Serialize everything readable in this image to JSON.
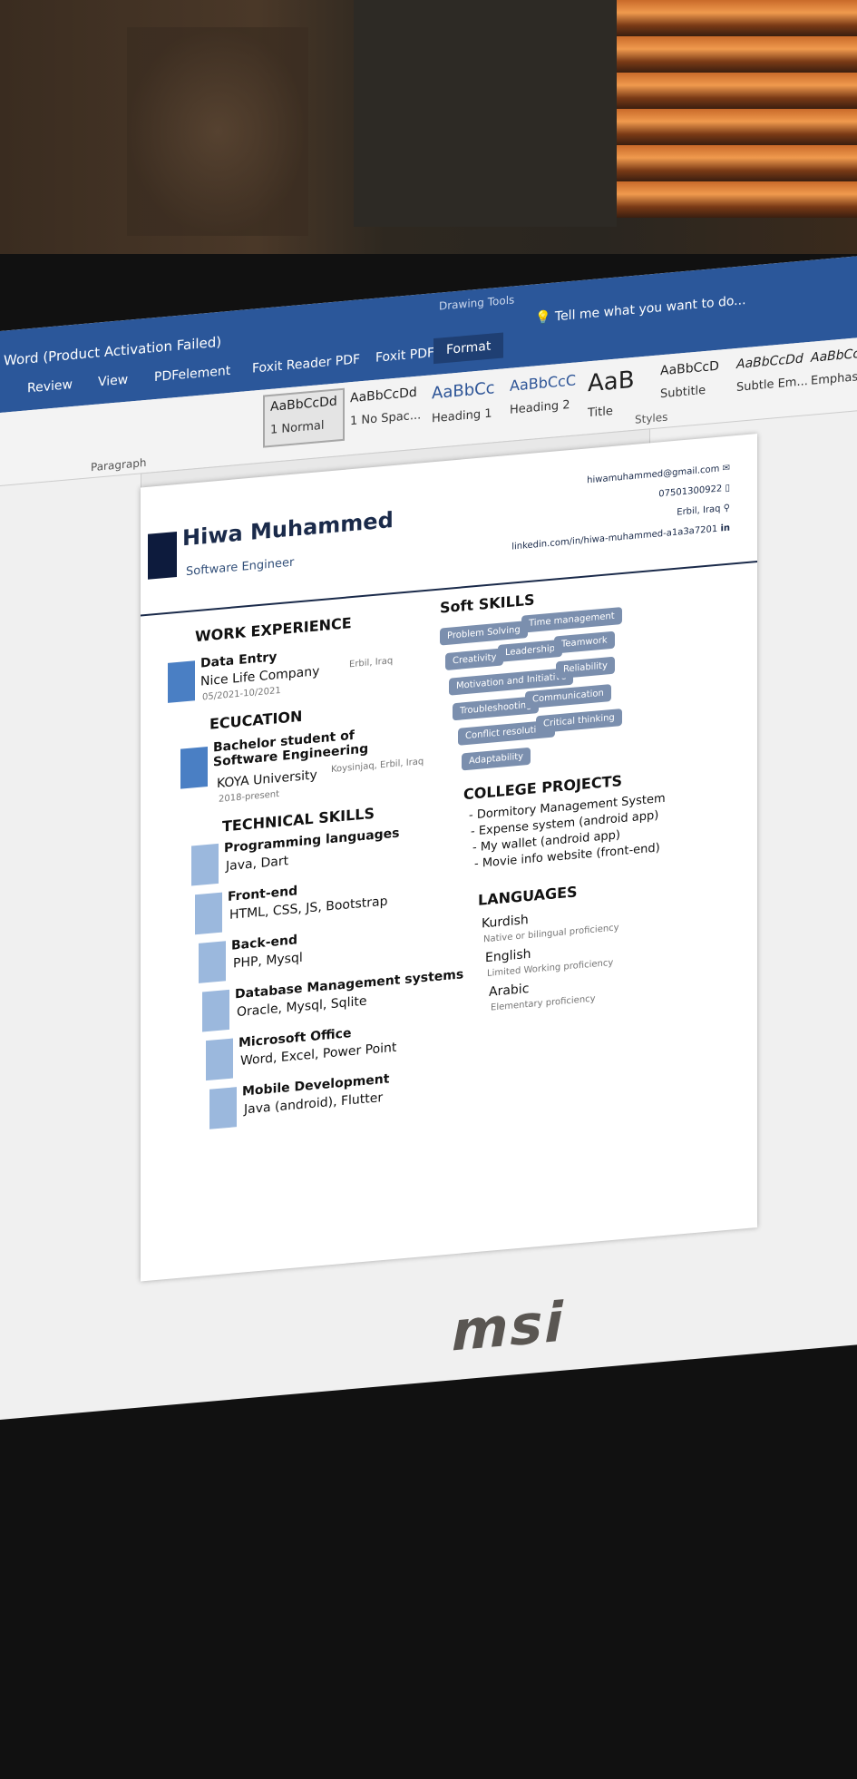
{
  "word": {
    "title": "Word (Product Activation Failed)",
    "tabs": [
      "Review",
      "View",
      "PDFelement",
      "Foxit Reader PDF",
      "Foxit PDF"
    ],
    "context_group": "Drawing Tools",
    "context_tab": "Format",
    "tell_me": "Tell me what you want to do...",
    "styles": [
      {
        "preview": "AaBbCcDd",
        "label": "1 Normal"
      },
      {
        "preview": "AaBbCcDd",
        "label": "1 No Spac..."
      },
      {
        "preview": "AaBbCc",
        "label": "Heading 1"
      },
      {
        "preview": "AaBbCcC",
        "label": "Heading 2"
      },
      {
        "preview": "AaB",
        "label": "Title"
      },
      {
        "preview": "AaBbCcD",
        "label": "Subtitle"
      },
      {
        "preview": "AaBbCcDd",
        "label": "Subtle Em..."
      },
      {
        "preview": "AaBbCcDd",
        "label": "Emphasis"
      }
    ],
    "group_paragraph": "Paragraph",
    "group_styles": "Styles"
  },
  "resume": {
    "name": "Hiwa Muhammed",
    "role": "Software Engineer",
    "email": "hiwamuhammed@gmail.com",
    "phone": "07501300922",
    "location": "Erbil, Iraq",
    "linkedin": "linkedin.com/in/hiwa-muhammed-a1a3a7201",
    "work_title": "WORK EXPERIENCE",
    "work": {
      "title": "Data Entry",
      "company": "Nice Life Company",
      "dates": "05/2021-10/2021",
      "place": "Erbil, Iraq"
    },
    "edu_title": "ECUCATION",
    "edu": {
      "degree": "Bachelor student of Software Engineering",
      "school": "KOYA University",
      "dates": "2018-present",
      "place": "Koysinjaq, Erbil, Iraq"
    },
    "tech_title": "TECHNICAL SKILLS",
    "tech": [
      {
        "h": "Programming languages",
        "t": "Java, Dart"
      },
      {
        "h": "Front-end",
        "t": "HTML, CSS, JS, Bootstrap"
      },
      {
        "h": "Back-end",
        "t": "PHP, Mysql"
      },
      {
        "h": "Database Management systems",
        "t": "Oracle, Mysql, Sqlite"
      },
      {
        "h": "Microsoft Office",
        "t": "Word, Excel, Power Point"
      },
      {
        "h": "Mobile Development",
        "t": "Java (android), Flutter"
      }
    ],
    "soft_title": "Soft SKILLS",
    "soft": [
      "Problem Solving",
      "Time management",
      "Creativity",
      "Leadership",
      "Teamwork",
      "Motivation and Initiative",
      "Reliability",
      "Troubleshooting",
      "Communication",
      "Conflict resolution",
      "Critical thinking",
      "Adaptability"
    ],
    "projects_title": "COLLEGE PROJECTS",
    "projects": [
      "Dormitory Management System",
      "Expense system (android app)",
      "My wallet (android app)",
      "Movie info website (front-end)"
    ],
    "lang_title": "LANGUAGES",
    "languages": [
      {
        "name": "Kurdish",
        "level": "Native or bilingual proficiency"
      },
      {
        "name": "English",
        "level": "Limited Working proficiency"
      },
      {
        "name": "Arabic",
        "level": "Elementary proficiency"
      }
    ]
  },
  "brand": "msi"
}
